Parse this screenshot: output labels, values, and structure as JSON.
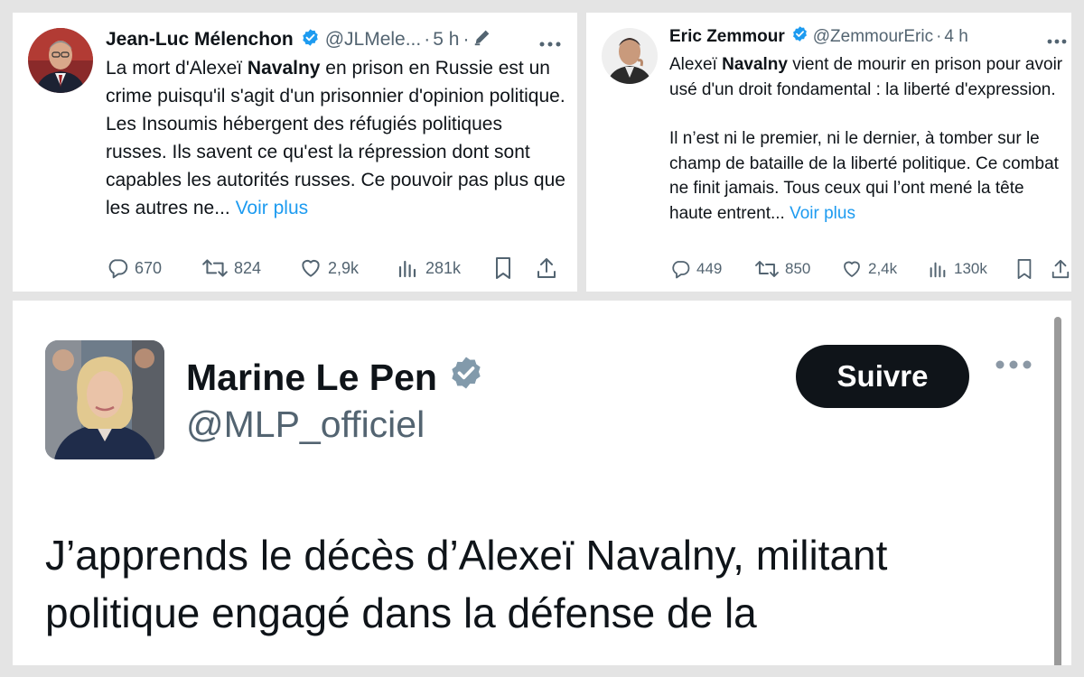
{
  "tweets": [
    {
      "name": "Jean-Luc Mélenchon",
      "handle": "@JLMele...",
      "separator": "·",
      "time": "5 h",
      "text_prefix": "La mort d'Alexeï ",
      "text_bold": "Navalny",
      "text_rest": " en prison en Russie est un crime puisqu'il s'agit d'un prisonnier d'opinion politique. Les Insoumis hébergent des réfugiés politiques russes. Ils savent ce qu'est la répression dont sont capables les autorités russes. Ce pouvoir pas plus que les autres ne... ",
      "more": "Voir plus",
      "replies": "670",
      "retweets": "824",
      "likes": "2,9k",
      "views": "281k"
    },
    {
      "name": "Eric Zemmour",
      "handle": "@ZemmourEric",
      "separator": "·",
      "time": "4 h",
      "text_prefix": "Alexeï ",
      "text_bold": "Navalny",
      "text_rest": " vient de mourir en prison pour avoir usé d'un droit fondamental : la liberté d'expression.",
      "text2": "Il n’est ni le premier, ni le dernier, à tomber sur le champ de bataille de la liberté politique. Ce combat ne finit jamais. Tous ceux qui l’ont mené la tête haute entrent... ",
      "more": "Voir plus",
      "replies": "449",
      "retweets": "850",
      "likes": "2,4k",
      "views": "130k"
    }
  ],
  "main_post": {
    "name": "Marine Le Pen",
    "handle": "@MLP_officiel",
    "follow_label": "Suivre",
    "text": "J’apprends le décès d’Alexeï Navalny, militant politique engagé dans la défense de la"
  },
  "colors": {
    "verified_blue": "#1d9bf0",
    "verified_gray": "#829aab",
    "link": "#1d9bf0",
    "muted": "#536471",
    "follow_bg": "#0f1419"
  },
  "icons": [
    "verified-icon",
    "edited-pencil-icon",
    "more-dots-icon",
    "reply-icon",
    "retweet-icon",
    "like-icon",
    "views-icon",
    "bookmark-icon",
    "share-icon"
  ]
}
